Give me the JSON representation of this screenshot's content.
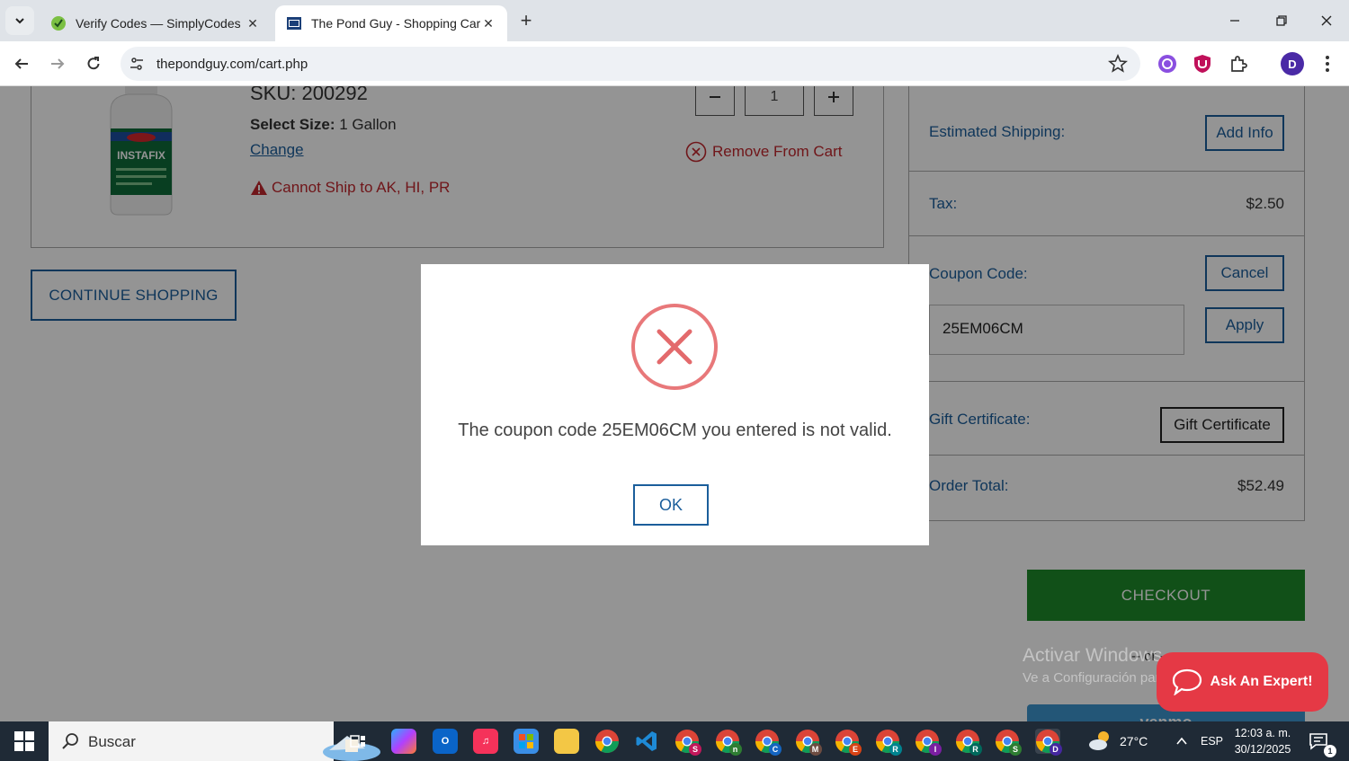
{
  "browser": {
    "tabs": [
      {
        "title": "Verify Codes — SimplyCodes",
        "active": false
      },
      {
        "title": "The Pond Guy - Shopping Cart",
        "active": true
      }
    ],
    "url": "thepondguy.com/cart.php",
    "profile_initial": "D"
  },
  "cart_item": {
    "image_label": "INSTAFIX",
    "sku": "SKU: 200292",
    "size_label": "Select Size:",
    "size_value": " 1 Gallon",
    "change_link": "Change",
    "ship_warning": "Cannot Ship to AK, HI, PR",
    "quantity": "1",
    "remove_label": "Remove From Cart"
  },
  "continue_shopping": "CONTINUE SHOPPING",
  "summary": {
    "shipping_label": "Estimated Shipping:",
    "add_info": "Add Info",
    "tax_label": "Tax:",
    "tax_value": "$2.50",
    "coupon_label": "Coupon Code:",
    "cancel": "Cancel",
    "coupon_value": "25EM06CM",
    "apply": "Apply",
    "gift_label": "Gift Certificate:",
    "gift_button": "Gift Certificate",
    "total_label": "Order Total:",
    "total_value": "$52.49"
  },
  "checkout": "CHECKOUT",
  "or_text": "-- or --",
  "venmo": "venmo",
  "ask_expert": "Ask An Expert!",
  "watermark": {
    "line1": "Activar Windows",
    "line2": "Ve a Configuración para activar Windows."
  },
  "modal": {
    "message": "The coupon code 25EM06CM you entered is not valid.",
    "ok": "OK"
  },
  "taskbar": {
    "search": "Buscar",
    "temperature": "27°C",
    "language": "ESP",
    "time": "12:03 a. m.",
    "date": "30/12/2025",
    "notifications": "1",
    "chrome_badges": [
      "S",
      "n",
      "C",
      "M",
      "E",
      "R",
      "I",
      "R",
      "S",
      "D"
    ]
  }
}
